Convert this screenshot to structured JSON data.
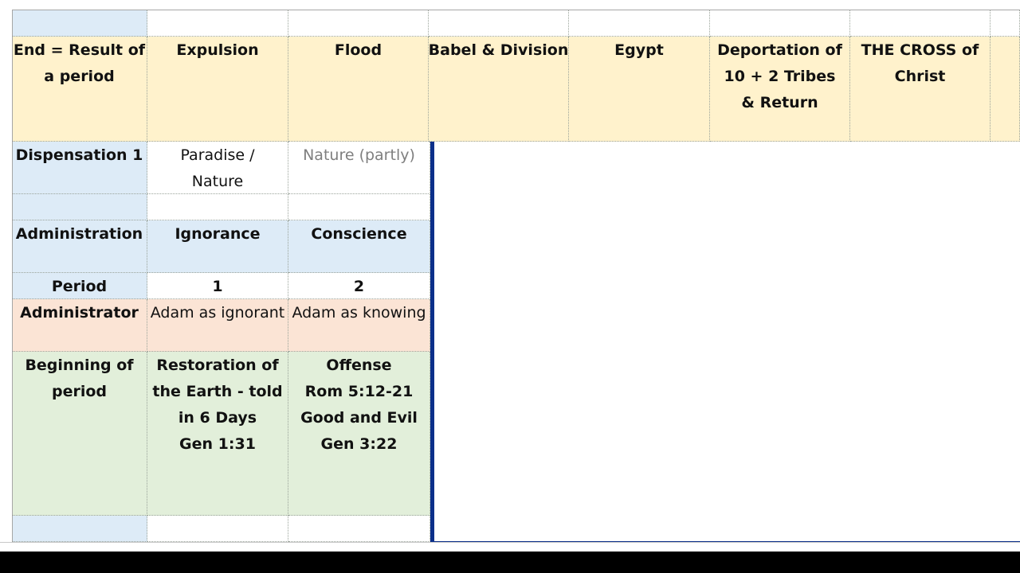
{
  "header": {
    "end_label": [
      "End = Result of",
      "a period"
    ],
    "columns": [
      [
        "Expulsion"
      ],
      [
        "Flood"
      ],
      [
        "Babel & Division"
      ],
      [
        "Egypt"
      ],
      [
        "Deportation of",
        "10 + 2 Tribes",
        "& Return"
      ],
      [
        "THE CROSS of",
        "Christ"
      ]
    ]
  },
  "rows": {
    "dispensation": {
      "label": "Dispensation 1",
      "c1": [
        "Paradise /",
        "Nature"
      ],
      "c2": "Nature (partly)"
    },
    "administration": {
      "label": "Administration",
      "c1": "Ignorance",
      "c2": "Conscience"
    },
    "period": {
      "label": "Period",
      "c1": "1",
      "c2": "2"
    },
    "administrator": {
      "label": "Administrator",
      "c1": "Adam as ignorant",
      "c2": "Adam as knowing"
    },
    "beginning": {
      "label": [
        "Beginning of",
        "period"
      ],
      "c1": [
        "Restoration of",
        "the Earth - told",
        "in 6 Days",
        "Gen 1:31"
      ],
      "c2": [
        "Offense",
        "Rom 5:12-21",
        "Good and Evil",
        "Gen 3:22"
      ]
    }
  },
  "colors": {
    "header_yellow": "#fff2cc",
    "label_blue": "#ddebf7",
    "administrator_pink": "#fbe4d5",
    "beginning_green": "#e2efda",
    "selection_border": "#0b2f8a"
  }
}
